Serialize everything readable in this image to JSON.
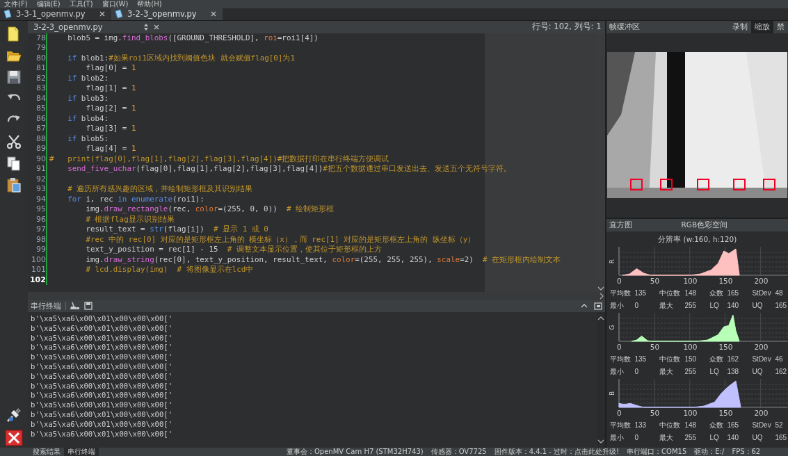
{
  "menu": [
    "文件(F)",
    "编辑(E)",
    "工具(T)",
    "窗口(W)",
    "帮助(H)"
  ],
  "file_tabs": [
    {
      "label": "3-3-1_openmv.py",
      "selected": false
    },
    {
      "label": "3-2-3_openmv.py",
      "selected": true
    }
  ],
  "editor": {
    "file": "3-2-3_openmv.py",
    "position": "行号: 102, 列号: 1",
    "lines": [
      {
        "number": "78",
        "current": false,
        "tokens": [
          {
            "kind": "plain",
            "text": "    blob5 = img."
          },
          {
            "kind": "func",
            "text": "find_blobs"
          },
          {
            "kind": "plain",
            "text": "([GROUND_THRESHOLD], "
          },
          {
            "kind": "param",
            "text": "roi"
          },
          {
            "kind": "plain",
            "text": "=roi1[4])"
          }
        ]
      },
      {
        "number": "79",
        "current": false
      },
      {
        "number": "80",
        "current": false,
        "tokens": [
          {
            "kind": "keyword",
            "text": "    if"
          },
          {
            "kind": "plain",
            "text": " blob1:"
          },
          {
            "kind": "comment",
            "text": "#如果roi1区域内找到阈值色块 就会赋值flag[0]为1"
          }
        ]
      },
      {
        "number": "81",
        "current": false,
        "tokens": [
          {
            "kind": "plain",
            "text": "        flag[0] = "
          },
          {
            "kind": "number",
            "text": "1"
          }
        ]
      },
      {
        "number": "82",
        "current": false,
        "tokens": [
          {
            "kind": "keyword",
            "text": "    if"
          },
          {
            "kind": "plain",
            "text": " blob2:"
          }
        ]
      },
      {
        "number": "83",
        "current": false,
        "tokens": [
          {
            "kind": "plain",
            "text": "        flag[1] = "
          },
          {
            "kind": "number",
            "text": "1"
          }
        ]
      },
      {
        "number": "84",
        "current": false,
        "tokens": [
          {
            "kind": "keyword",
            "text": "    if"
          },
          {
            "kind": "plain",
            "text": " blob3:"
          }
        ]
      },
      {
        "number": "85",
        "current": false,
        "tokens": [
          {
            "kind": "plain",
            "text": "        flag[2] = "
          },
          {
            "kind": "number",
            "text": "1"
          }
        ]
      },
      {
        "number": "86",
        "current": false,
        "tokens": [
          {
            "kind": "keyword",
            "text": "    if"
          },
          {
            "kind": "plain",
            "text": " blob4:"
          }
        ]
      },
      {
        "number": "87",
        "current": false,
        "tokens": [
          {
            "kind": "plain",
            "text": "        flag[3] = "
          },
          {
            "kind": "number",
            "text": "1"
          }
        ]
      },
      {
        "number": "88",
        "current": false,
        "tokens": [
          {
            "kind": "keyword",
            "text": "    if"
          },
          {
            "kind": "plain",
            "text": " blob5:"
          }
        ]
      },
      {
        "number": "89",
        "current": false,
        "tokens": [
          {
            "kind": "plain",
            "text": "        flag[4] = "
          },
          {
            "kind": "number",
            "text": "1"
          }
        ]
      },
      {
        "number": "90",
        "current": false,
        "tokens": [
          {
            "kind": "comment",
            "text": "#   print(flag[0],flag[1],flag[2],flag[3],flag[4])#把数据打印在串行终端方便调试"
          }
        ]
      },
      {
        "number": "91",
        "current": false,
        "tokens": [
          {
            "kind": "func",
            "text": "    send_five_uchar"
          },
          {
            "kind": "plain",
            "text": "(flag[0],flag[1],flag[2],flag[3],flag[4])"
          },
          {
            "kind": "comment",
            "text": "#把五个数据通过串口发送出去、发送五个无符号字符。"
          }
        ]
      },
      {
        "number": "92",
        "current": false
      },
      {
        "number": "93",
        "current": false,
        "tokens": [
          {
            "kind": "comment",
            "text": "    # 遍历所有感兴趣的区域，并绘制矩形框及其识别结果"
          }
        ]
      },
      {
        "number": "94",
        "current": false,
        "tokens": [
          {
            "kind": "keyword",
            "text": "    for"
          },
          {
            "kind": "plain",
            "text": " i, rec "
          },
          {
            "kind": "keyword",
            "text": "in"
          },
          {
            "kind": "builtin",
            "text": " enumerate"
          },
          {
            "kind": "plain",
            "text": "(roi1):"
          }
        ]
      },
      {
        "number": "95",
        "current": false,
        "tokens": [
          {
            "kind": "plain",
            "text": "        img."
          },
          {
            "kind": "func",
            "text": "draw_rectangle"
          },
          {
            "kind": "plain",
            "text": "(rec, "
          },
          {
            "kind": "param",
            "text": "color"
          },
          {
            "kind": "plain",
            "text": "=(255, 0, 0))  "
          },
          {
            "kind": "comment",
            "text": "# 绘制矩形框"
          }
        ]
      },
      {
        "number": "96",
        "current": false,
        "tokens": [
          {
            "kind": "comment",
            "text": "        # 根据flag显示识别结果"
          }
        ]
      },
      {
        "number": "97",
        "current": false,
        "tokens": [
          {
            "kind": "plain",
            "text": "        result_text = "
          },
          {
            "kind": "builtin",
            "text": "str"
          },
          {
            "kind": "plain",
            "text": "(flag[i])  "
          },
          {
            "kind": "comment",
            "text": "# 显示 1 或 0"
          }
        ]
      },
      {
        "number": "98",
        "current": false,
        "tokens": [
          {
            "kind": "comment",
            "text": "        #rec 中的 rec[0] 对应的是矩形框左上角的 横坐标（x），而 rec[1] 对应的是矩形框左上角的 纵坐标（y）"
          }
        ]
      },
      {
        "number": "99",
        "current": false,
        "tokens": [
          {
            "kind": "plain",
            "text": "        text_y_position = rec[1] - 15  "
          },
          {
            "kind": "comment",
            "text": "# 调整文本显示位置，使其位于矩形框的上方"
          }
        ]
      },
      {
        "number": "100",
        "current": false,
        "tokens": [
          {
            "kind": "plain",
            "text": "        img."
          },
          {
            "kind": "func",
            "text": "draw_string"
          },
          {
            "kind": "plain",
            "text": "(rec[0], text_y_position, result_text, "
          },
          {
            "kind": "param",
            "text": "color"
          },
          {
            "kind": "plain",
            "text": "=(255, 255, 255), "
          },
          {
            "kind": "param",
            "text": "scale"
          },
          {
            "kind": "plain",
            "text": "=2)  "
          },
          {
            "kind": "comment",
            "text": "# 在矩形框内绘制文本"
          }
        ]
      },
      {
        "number": "101",
        "current": false,
        "tokens": [
          {
            "kind": "comment",
            "text": "        # lcd.display(img)  # 将图像显示在lcd中"
          }
        ]
      },
      {
        "number": "102",
        "current": true
      }
    ]
  },
  "terminal": {
    "title": "串行终端",
    "lines": [
      "b'\\xa5\\xa6\\x00\\x01\\x00\\x00\\x00['",
      "b'\\xa5\\xa6\\x00\\x01\\x00\\x00\\x00['",
      "b'\\xa5\\xa6\\x00\\x01\\x00\\x00\\x00['",
      "b'\\xa5\\xa6\\x00\\x01\\x00\\x00\\x00['",
      "b'\\xa5\\xa6\\x00\\x01\\x00\\x00\\x00['",
      "b'\\xa5\\xa6\\x00\\x01\\x00\\x00\\x00['",
      "b'\\xa5\\xa6\\x00\\x01\\x00\\x00\\x00['",
      "b'\\xa5\\xa6\\x00\\x01\\x00\\x00\\x00['",
      "b'\\xa5\\xa6\\x00\\x01\\x00\\x00\\x00['",
      "b'\\xa5\\xa6\\x00\\x01\\x00\\x00\\x00['",
      "b'\\xa5\\xa6\\x00\\x01\\x00\\x00\\x00['",
      "b'\\xa5\\xa6\\x00\\x01\\x00\\x00\\x00['",
      "b'\\xa5\\xa6\\x00\\x01\\x00\\x00\\x00['"
    ]
  },
  "frame_buffer": {
    "title": "帧缓冲区",
    "buttons": [
      {
        "label": "录制",
        "selected": false
      },
      {
        "label": "缩放",
        "selected": true
      },
      {
        "label": "禁",
        "selected": false
      }
    ]
  },
  "histogram": {
    "title": "直方图",
    "color_space": "RGB色彩空间",
    "resolution": "分辨率 (w:160, h:120)",
    "channels": [
      {
        "axis": "R",
        "color": "#ffc0c0",
        "ticks": [
          "0",
          "50",
          "100",
          "150",
          "200"
        ],
        "stats": [
          {
            "label": "平均数",
            "value": "135"
          },
          {
            "label": "中位数",
            "value": "148"
          },
          {
            "label": "众数",
            "value": "165"
          },
          {
            "label": "StDev",
            "value": "48"
          },
          {
            "label": "最小",
            "value": "0"
          },
          {
            "label": "最大",
            "value": "255"
          },
          {
            "label": "LQ",
            "value": "140"
          },
          {
            "label": "UQ",
            "value": "165"
          }
        ]
      },
      {
        "axis": "G",
        "color": "#b8ffb8",
        "ticks": [
          "0",
          "50",
          "100",
          "150",
          "200"
        ],
        "stats": [
          {
            "label": "平均数",
            "value": "135"
          },
          {
            "label": "中位数",
            "value": "150"
          },
          {
            "label": "众数",
            "value": "162"
          },
          {
            "label": "StDev",
            "value": "46"
          },
          {
            "label": "最小",
            "value": "0"
          },
          {
            "label": "最大",
            "value": "255"
          },
          {
            "label": "LQ",
            "value": "138"
          },
          {
            "label": "UQ",
            "value": "162"
          }
        ]
      },
      {
        "axis": "B",
        "color": "#c0c0ff",
        "ticks": [
          "0",
          "50",
          "100",
          "150",
          "200"
        ],
        "stats": [
          {
            "label": "平均数",
            "value": "133"
          },
          {
            "label": "中位数",
            "value": "148"
          },
          {
            "label": "众数",
            "value": "165"
          },
          {
            "label": "StDev",
            "value": "52"
          },
          {
            "label": "最小",
            "value": "0"
          },
          {
            "label": "最大",
            "value": "255"
          },
          {
            "label": "LQ",
            "value": "140"
          },
          {
            "label": "UQ",
            "value": "165"
          }
        ]
      }
    ]
  },
  "status_bar": {
    "tabs": [
      {
        "label": "搜索结果",
        "selected": false
      },
      {
        "label": "串行终端",
        "selected": true
      }
    ],
    "items": [
      "董事会：OpenMV Cam H7 (STM32H743)",
      "传感器：OV7725",
      "固件版本：4.4.1 - 过时：点击此处升级!",
      "串行端口：COM15",
      "驱动：E:/",
      "FPS：62"
    ]
  }
}
